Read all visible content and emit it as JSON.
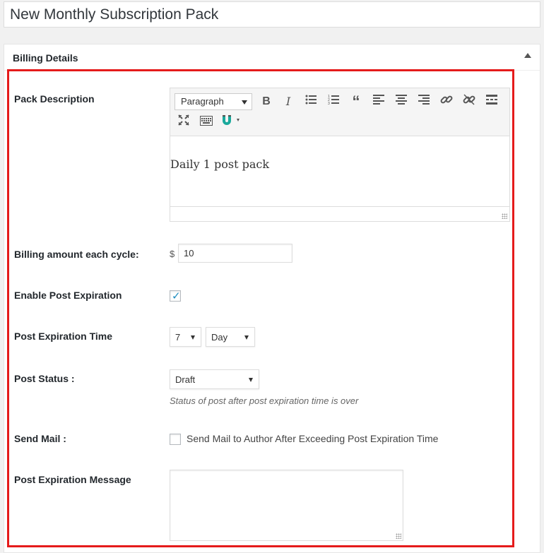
{
  "title": "New Monthly Subscription Pack",
  "panel": {
    "title": "Billing Details",
    "toggle_icon": "triangle-up-icon"
  },
  "colors": {
    "highlight": "#e51b1b",
    "accent": "#1e8cbe"
  },
  "fields": {
    "pack_description": {
      "label": "Pack Description",
      "format_value": "Paragraph",
      "content": "Daily 1 post pack",
      "toolbar_icons": [
        "bold-icon",
        "italic-icon",
        "bullet-list-icon",
        "numbered-list-icon",
        "blockquote-icon",
        "align-left-icon",
        "align-center-icon",
        "align-right-icon",
        "link-icon",
        "unlink-icon",
        "read-more-icon",
        "fullscreen-icon",
        "keyboard-icon",
        "plugin-icon"
      ]
    },
    "billing_amount": {
      "label": "Billing amount each cycle:",
      "currency": "$",
      "value": "10"
    },
    "enable_expiration": {
      "label": "Enable Post Expiration",
      "checked": true
    },
    "expiration_time": {
      "label": "Post Expiration Time",
      "number": "7",
      "unit": "Day"
    },
    "post_status": {
      "label": "Post Status :",
      "value": "Draft",
      "hint": "Status of post after post expiration time is over"
    },
    "send_mail": {
      "label": "Send Mail :",
      "checked": false,
      "option_text": "Send Mail to Author After Exceeding Post Expiration Time"
    },
    "expiration_message": {
      "label": "Post Expiration Message",
      "value": ""
    }
  }
}
